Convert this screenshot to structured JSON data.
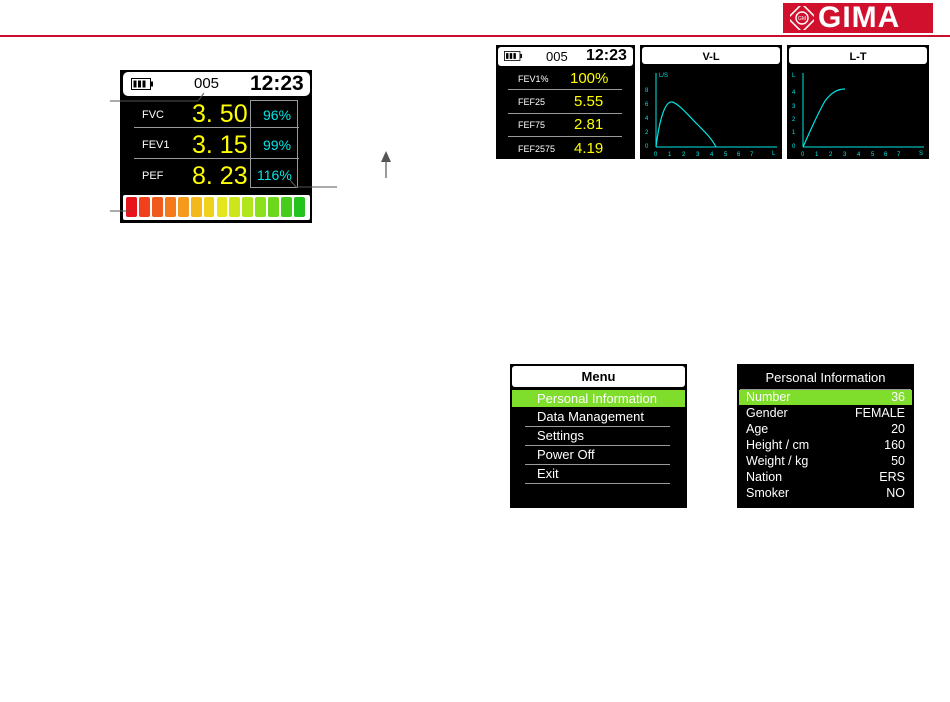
{
  "brand": {
    "name": "GIMA",
    "primary_color": "#c8102e"
  },
  "main_screen": {
    "battery_icon": "battery-icon",
    "number": "005",
    "time": "12:23",
    "rows": [
      {
        "label": "FVC",
        "value": "3. 50",
        "percent": "96%"
      },
      {
        "label": "FEV1",
        "value": "3. 15",
        "percent": "99%"
      },
      {
        "label": "PEF",
        "value": "8. 23",
        "percent": "116%"
      }
    ],
    "bar_colors": [
      "#e8141c",
      "#f0401c",
      "#f05a1c",
      "#f57a1c",
      "#f59a1c",
      "#f5b81c",
      "#f0d21c",
      "#e6e61c",
      "#cce61c",
      "#b0e61c",
      "#8ce11c",
      "#6cd81c",
      "#46cd1c",
      "#22c31c"
    ]
  },
  "results_screen": {
    "number": "005",
    "time": "12:23",
    "rows": [
      {
        "label": "FEV1%",
        "value": "100%"
      },
      {
        "label": "FEF25",
        "value": "5.55"
      },
      {
        "label": "FEF75",
        "value": "2.81"
      },
      {
        "label": "FEF2575",
        "value": "4.19"
      }
    ]
  },
  "vl_chart": {
    "title": "V-L",
    "y_unit": "L/S",
    "x_unit": "L",
    "y_ticks": [
      "8",
      "6",
      "4",
      "2",
      "0"
    ],
    "x_ticks": [
      "0",
      "1",
      "2",
      "3",
      "4",
      "5",
      "6",
      "7"
    ]
  },
  "lt_chart": {
    "title": "L-T",
    "y_unit": "L",
    "x_unit": "S",
    "y_ticks": [
      "4",
      "3",
      "2",
      "1",
      "0"
    ],
    "x_ticks": [
      "0",
      "1",
      "2",
      "3",
      "4",
      "5",
      "6",
      "7"
    ]
  },
  "menu_screen": {
    "title": "Menu",
    "items": [
      "Personal Information",
      "Data Management",
      "Settings",
      "Power Off",
      "Exit"
    ],
    "selected_color": "#7fdd2c"
  },
  "info_screen": {
    "title": "Personal Information",
    "rows": [
      {
        "label": "Number",
        "value": "36"
      },
      {
        "label": "Gender",
        "value": "FEMALE"
      },
      {
        "label": "Age",
        "value": "20"
      },
      {
        "label": "Height / cm",
        "value": "160"
      },
      {
        "label": "Weight / kg",
        "value": "50"
      },
      {
        "label": "Nation",
        "value": "ERS"
      },
      {
        "label": "Smoker",
        "value": "NO"
      }
    ]
  }
}
